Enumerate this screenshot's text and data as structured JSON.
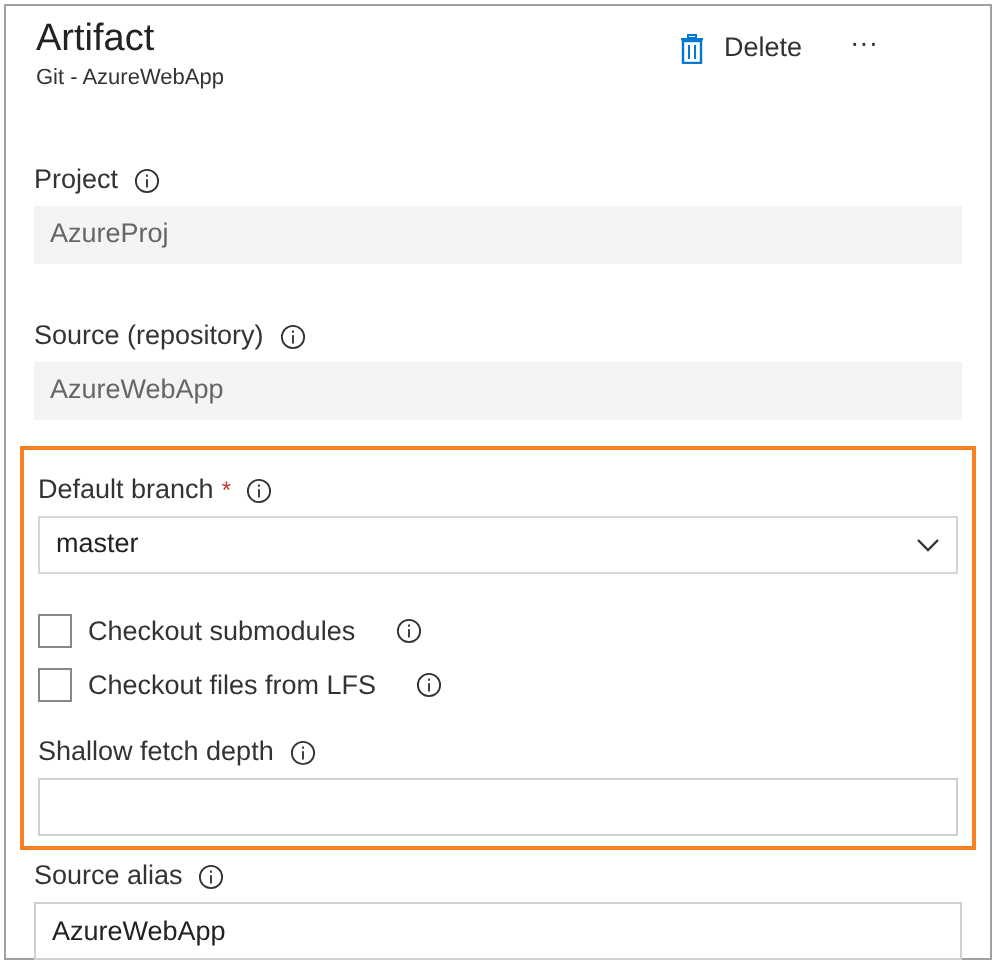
{
  "header": {
    "title": "Artifact",
    "subtitle": "Git - AzureWebApp",
    "delete_label": "Delete",
    "more_label": "···"
  },
  "sections": [
    {
      "kind": "plain",
      "fields": [
        {
          "kind": "readonly",
          "label": "Project",
          "value": "AzureProj"
        },
        {
          "kind": "readonly",
          "label": "Source (repository)",
          "value": "AzureWebApp"
        }
      ]
    },
    {
      "kind": "highlighted",
      "fields": [
        {
          "kind": "select",
          "label": "Default branch",
          "required_mark": "*",
          "value": "master"
        },
        {
          "kind": "checkbox",
          "label": "Checkout submodules",
          "checked": false
        },
        {
          "kind": "checkbox",
          "label": "Checkout files from LFS",
          "checked": false
        },
        {
          "kind": "text",
          "label": "Shallow fetch depth"
        }
      ]
    },
    {
      "kind": "plain",
      "fields": [
        {
          "kind": "text",
          "label": "Source alias",
          "value": "AzureWebApp"
        }
      ]
    }
  ]
}
